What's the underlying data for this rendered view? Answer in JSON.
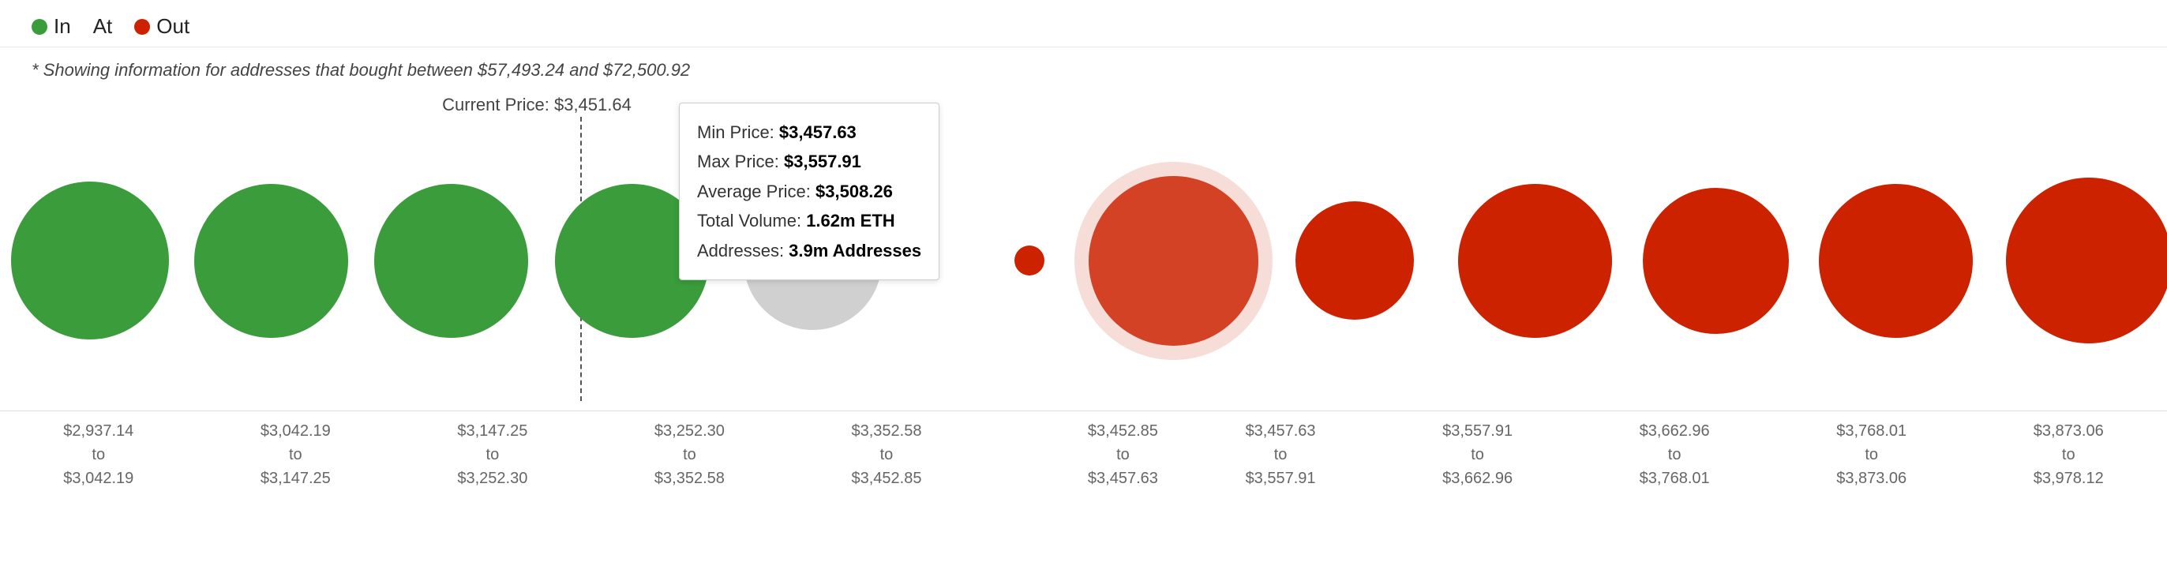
{
  "legend": {
    "items": [
      {
        "id": "in",
        "label": "In",
        "color": "green"
      },
      {
        "id": "at",
        "label": "At",
        "color": "none"
      },
      {
        "id": "out",
        "label": "Out",
        "color": "red"
      }
    ]
  },
  "subtitle": "* Showing information for addresses that bought between $57,493.24 and $72,500.92",
  "currentPrice": {
    "label": "Current Price: $3,451.64"
  },
  "tooltip": {
    "minPrice": {
      "label": "Min Price: ",
      "value": "$3,457.63"
    },
    "maxPrice": {
      "label": "Max Price: ",
      "value": "$3,557.91"
    },
    "avgPrice": {
      "label": "Average Price: ",
      "value": "$3,508.26"
    },
    "totalVolume": {
      "label": "Total Volume: ",
      "value": "1.62m ETH"
    },
    "addresses": {
      "label": "Addresses: ",
      "value": "3.9m Addresses"
    }
  },
  "bubbles": [
    {
      "id": 1,
      "color": "green",
      "size": 200,
      "type": "in"
    },
    {
      "id": 2,
      "color": "green",
      "size": 195,
      "type": "in"
    },
    {
      "id": 3,
      "color": "green",
      "size": 195,
      "type": "in"
    },
    {
      "id": 4,
      "color": "green",
      "size": 195,
      "type": "in"
    },
    {
      "id": 5,
      "color": "lightgray",
      "size": 175,
      "type": "at"
    },
    {
      "id": 6,
      "color": "red-small",
      "size": 38,
      "type": "out"
    },
    {
      "id": 7,
      "color": "red-big",
      "size": 215,
      "type": "out",
      "highlighted": true
    },
    {
      "id": 8,
      "color": "red",
      "size": 150,
      "type": "out"
    },
    {
      "id": 9,
      "color": "red",
      "size": 195,
      "type": "out"
    },
    {
      "id": 10,
      "color": "red",
      "size": 185,
      "type": "out"
    },
    {
      "id": 11,
      "color": "red",
      "size": 195,
      "type": "out"
    },
    {
      "id": 12,
      "color": "red",
      "size": 210,
      "type": "out"
    }
  ],
  "axisLabels": [
    {
      "line1": "$2,937.14",
      "line2": "to",
      "line3": "$3,042.19"
    },
    {
      "line1": "$3,042.19",
      "line2": "to",
      "line3": "$3,147.25"
    },
    {
      "line1": "$3,147.25",
      "line2": "to",
      "line3": "$3,252.30"
    },
    {
      "line1": "$3,252.30",
      "line2": "to",
      "line3": "$3,352.58"
    },
    {
      "line1": "$3,352.58",
      "line2": "to",
      "line3": "$3,452.85"
    },
    {
      "line1": "$3,452.85",
      "line2": "to",
      "line3": "$3,457.63"
    },
    {
      "line1": "$3,457.63",
      "line2": "to",
      "line3": "$3,557.91"
    },
    {
      "line1": "$3,557.91",
      "line2": "to",
      "line3": "$3,662.96"
    },
    {
      "line1": "$3,662.96",
      "line2": "to",
      "line3": "$3,768.01"
    },
    {
      "line1": "$3,768.01",
      "line2": "to",
      "line3": "$3,873.06"
    },
    {
      "line1": "$3,873.06",
      "line2": "to",
      "line3": "$3,978.12"
    }
  ],
  "colors": {
    "green": "#3a9c3a",
    "red": "#cc2200",
    "lightgray": "#d0d0d0",
    "accent": "#cc2200"
  }
}
